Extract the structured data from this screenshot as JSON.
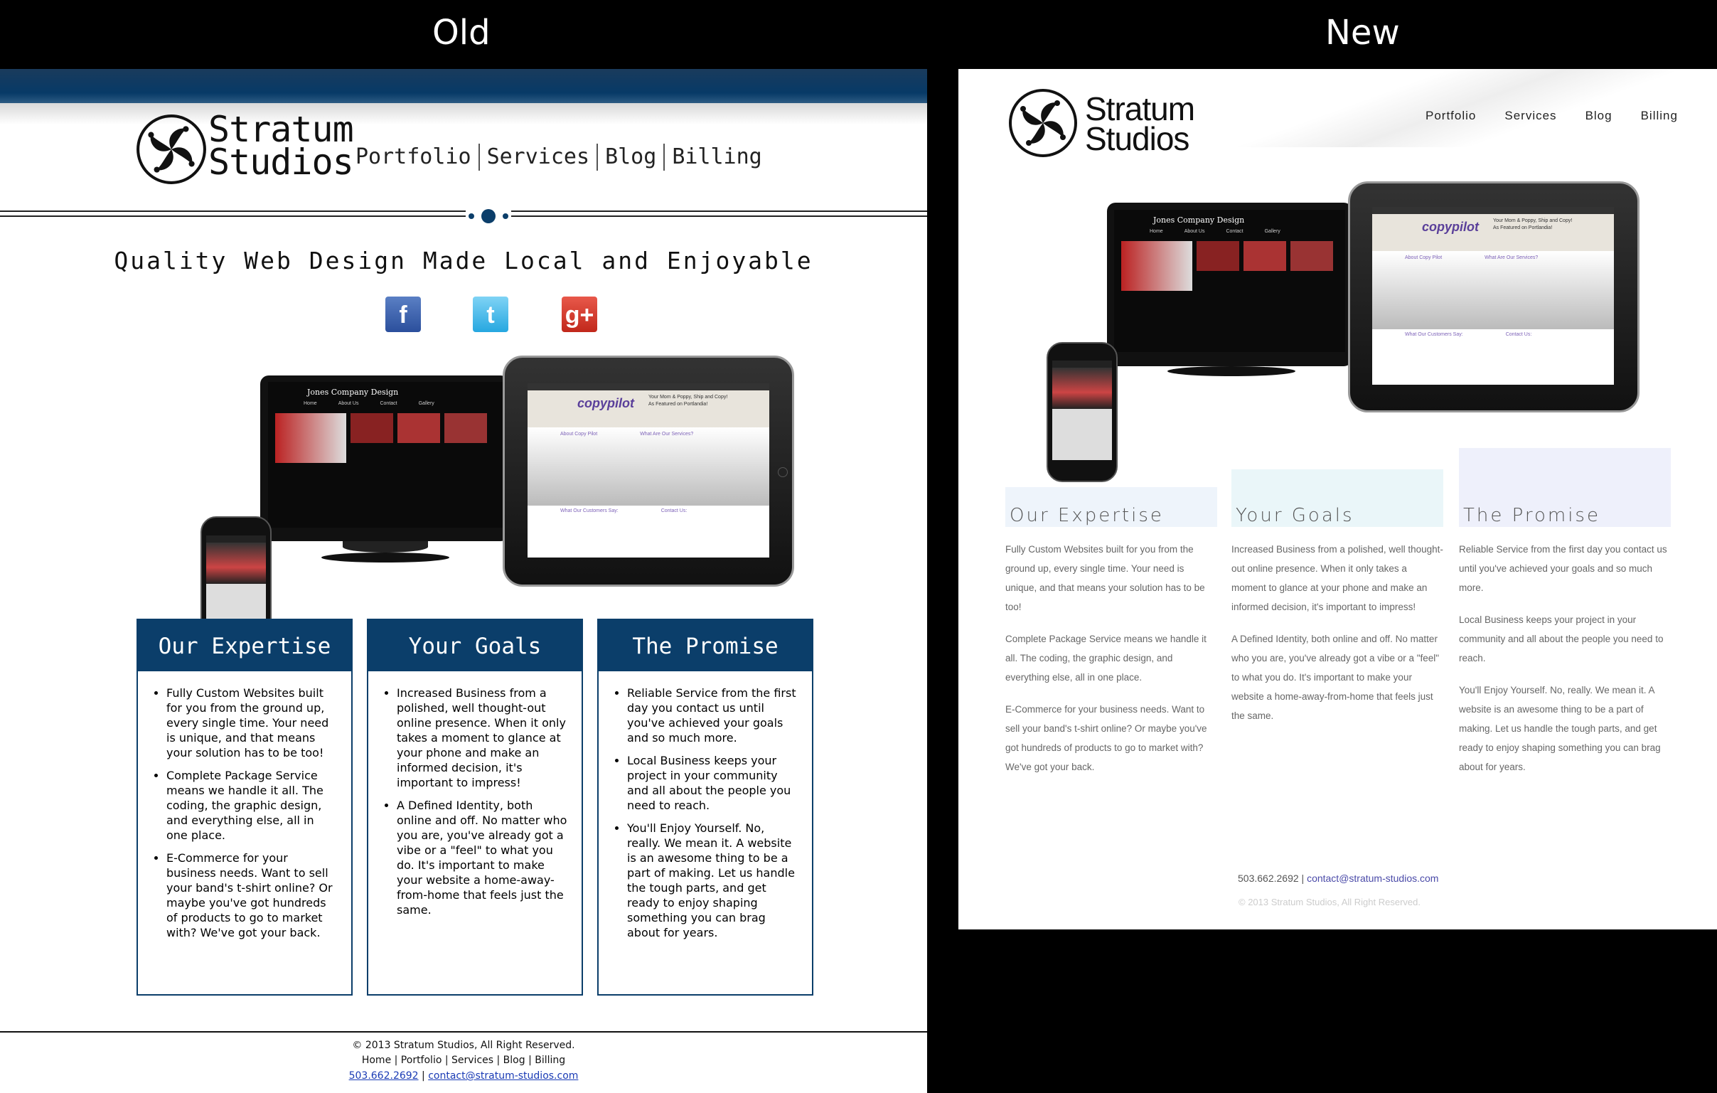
{
  "labels": {
    "old": "Old",
    "new": "New"
  },
  "brand": {
    "line1": "Stratum",
    "line2": "Studios"
  },
  "old": {
    "nav": [
      "Portfolio",
      "Services",
      "Blog",
      "Billing"
    ],
    "tagline": "Quality Web Design Made Local and Enjoyable",
    "social": [
      "facebook-icon",
      "twitter-icon",
      "google-plus-icon"
    ],
    "columns": [
      {
        "title": "Our Expertise",
        "items": [
          "Fully Custom Websites built for you from the ground up, every single time. Your need is unique, and that means your solution has to be too!",
          "Complete Package Service means we handle it all. The coding, the graphic design, and everything else, all in one place.",
          "E-Commerce for your business needs. Want to sell your band's t-shirt online? Or maybe you've got hundreds of products to go to market with? We've got your back."
        ]
      },
      {
        "title": "Your Goals",
        "items": [
          "Increased Business from a polished, well thought-out online presence. When it only takes a moment to glance at your phone and make an informed decision, it's important to impress!",
          "A Defined Identity, both online and off. No matter who you are, you've already got a vibe or a \"feel\" to what you do. It's important to make your website a home-away-from-home that feels just the same."
        ]
      },
      {
        "title": "The Promise",
        "items": [
          "Reliable Service from the first day you contact us until you've achieved your goals and so much more.",
          "Local Business keeps your project in your community and all about the people you need to reach.",
          "You'll Enjoy Yourself. No, really. We mean it. A website is an awesome thing to be a part of making. Let us handle the tough parts, and get ready to enjoy shaping something you can brag about for years."
        ]
      }
    ],
    "footer": {
      "copyright": "© 2013 Stratum Studios, All Right Reserved.",
      "links": "Home | Portfolio | Services | Blog | Billing",
      "phone": "503.662.2692",
      "sep": " | ",
      "email": "contact@stratum-studios.com"
    }
  },
  "mockup": {
    "tv_title": "Jones Company Design",
    "tv_nav": [
      "Home",
      "About Us",
      "Contact",
      "Gallery"
    ],
    "ipad_brand": "copypilot",
    "ipad_line1": "Your Mom & Poppy, Ship and Copy!",
    "ipad_line2": "As Featured on Portlandia!",
    "ipad_about": "About Copy Pilot",
    "ipad_services": "What Are Our Services?",
    "ipad_customers": "What Our Customers Say:",
    "ipad_contact": "Contact Us:"
  },
  "new": {
    "nav": [
      "Portfolio",
      "Services",
      "Blog",
      "Billing"
    ],
    "columns": [
      {
        "title": "Our Expertise",
        "tint": "#eef4fb",
        "paras": [
          "Fully Custom Websites built for you from the ground up, every single time. Your need is unique, and that means your solution has to be too!",
          "Complete Package Service means we handle it all. The coding, the graphic design, and everything else, all in one place.",
          "E-Commerce for your business needs. Want to sell your band's t-shirt online? Or maybe you've got hundreds of products to go to market with? We've got your back."
        ]
      },
      {
        "title": "Your Goals",
        "tint": "#eaf6f9",
        "paras": [
          "Increased Business from a polished, well thought-out online presence. When it only takes a moment to glance at your phone and make an informed decision, it's important to impress!",
          "A Defined Identity, both online and off. No matter who you are, you've already got a vibe or a \"feel\" to what you do. It's important to make your website a home-away-from-home that feels just the same."
        ]
      },
      {
        "title": "The Promise",
        "tint": "#eef0fb",
        "paras": [
          "Reliable Service from the first day you contact us until you've achieved your goals and so much more.",
          "Local Business keeps your project in your community and all about the people you need to reach.",
          "You'll Enjoy Yourself. No, really. We mean it. A website is an awesome thing to be a part of making. Let us handle the tough parts, and get ready to enjoy shaping something you can brag about for years."
        ]
      }
    ],
    "footer": {
      "phone": "503.662.2692",
      "sep": " | ",
      "email": "contact@stratum-studios.com",
      "copyright": "© 2013 Stratum Studios, All Right Reserved."
    }
  }
}
